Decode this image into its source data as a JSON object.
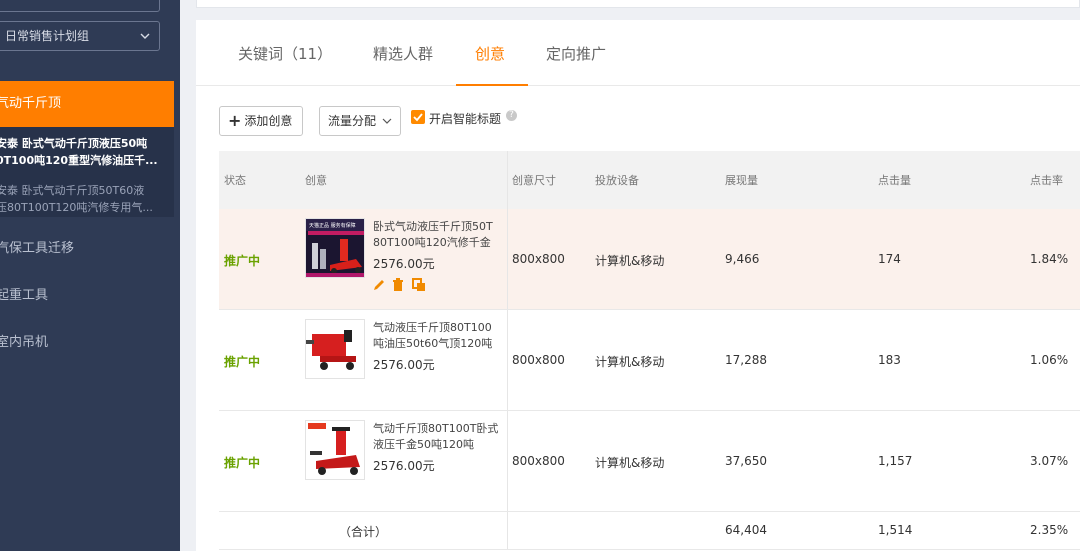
{
  "sidebar": {
    "plan_select": "日常销售计划组",
    "active_group": "气动千斤顶",
    "sub_items": [
      "安泰 卧式气动千斤顶液压50吨80T100吨120重型汽修油压千...",
      "安泰 卧式气动千斤顶50T60液压80T100T120吨汽修专用气..."
    ],
    "sub_item_lines": [
      [
        "安泰 卧式气动千斤顶液压50吨",
        "0T100吨120重型汽修油压千..."
      ],
      [
        "安泰 卧式气动千斤顶50T60液",
        "压80T100T120吨汽修专用气..."
      ]
    ],
    "links": [
      "汽保工具迁移",
      "起重工具",
      "室内吊机"
    ]
  },
  "tabs": [
    {
      "label": "关键词（11）",
      "active": false
    },
    {
      "label": "精选人群",
      "active": false
    },
    {
      "label": "创意",
      "active": true
    },
    {
      "label": "定向推广",
      "active": false
    }
  ],
  "toolbar": {
    "add_label": "添加创意",
    "flow_label": "流量分配",
    "smart_title_label": "开启智能标题",
    "smart_title_checked": true
  },
  "table": {
    "headers": [
      "状态",
      "创意",
      "创意尺寸",
      "投放设备",
      "展现量",
      "点击量",
      "点击率"
    ],
    "rows": [
      {
        "status": "推广中",
        "title": "卧式气动液压千斤顶50T80T100吨120汽修千金",
        "title_lines": [
          "卧式气动液压千斤顶50T",
          "80T100吨120汽修千金"
        ],
        "price": "2576.00元",
        "size": "800x800",
        "device": "计算机&移动",
        "views": "9,466",
        "clicks": "174",
        "ctr": "1.84%",
        "thumb_banner": "天猫正品 服务有保障"
      },
      {
        "status": "推广中",
        "title": "气动液压千斤顶80T100吨油压50t60气顶120吨",
        "title_lines": [
          "气动液压千斤顶80T100",
          "吨油压50t60气顶120吨"
        ],
        "price": "2576.00元",
        "size": "800x800",
        "device": "计算机&移动",
        "views": "17,288",
        "clicks": "183",
        "ctr": "1.06%"
      },
      {
        "status": "推广中",
        "title": "气动千斤顶80T100T卧式液压千金50吨120吨",
        "title_lines": [
          "气动千斤顶80T100T卧式",
          "液压千金50吨120吨"
        ],
        "price": "2576.00元",
        "size": "800x800",
        "device": "计算机&移动",
        "views": "37,650",
        "clicks": "1,157",
        "ctr": "3.07%"
      }
    ],
    "total": {
      "label": "（合计）",
      "views": "64,404",
      "clicks": "1,514",
      "ctr": "2.35%"
    }
  },
  "colors": {
    "sidebar_bg": "#2f3b55",
    "accent": "#ff7e00",
    "status_green": "#6aa200",
    "highlight_row": "#fbf1ec"
  },
  "icons": [
    "chevron-down-icon",
    "plus-icon",
    "pencil-icon",
    "trash-icon",
    "copy-icon",
    "help-icon",
    "checkbox-checked-icon"
  ]
}
